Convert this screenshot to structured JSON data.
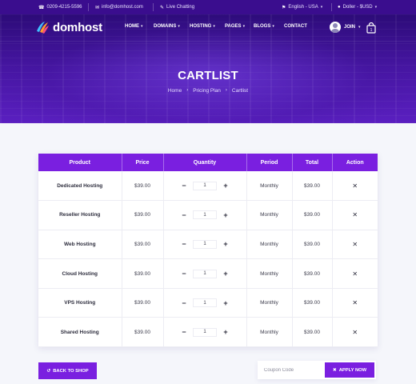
{
  "topbar": {
    "phone": "0209-4215-5596",
    "email": "info@domhost.com",
    "chat": "Live Chatting",
    "language": "English - USA",
    "currency": "Doller - $USD"
  },
  "brand": {
    "name": "domhost"
  },
  "nav": {
    "items": [
      {
        "label": "HOME"
      },
      {
        "label": "DOMAINS"
      },
      {
        "label": "HOSTING"
      },
      {
        "label": "PAGES"
      },
      {
        "label": "BLOGS"
      },
      {
        "label": "CONTACT"
      }
    ],
    "join_label": "JOIN"
  },
  "hero": {
    "title": "CARTLIST",
    "breadcrumb": [
      "Home",
      "Pricing Plan",
      "Cartlist"
    ]
  },
  "cart_table": {
    "headers": [
      "Product",
      "Price",
      "Quantity",
      "Period",
      "Total",
      "Action"
    ],
    "rows": [
      {
        "product": "Dedicated Hosting",
        "price": "$39.00",
        "quantity": "1",
        "period": "Monthly",
        "total": "$39.00"
      },
      {
        "product": "Reseller Hosting",
        "price": "$39.00",
        "quantity": "1",
        "period": "Monthly",
        "total": "$39.00"
      },
      {
        "product": "Web Hosting",
        "price": "$39.00",
        "quantity": "1",
        "period": "Monthly",
        "total": "$39.00"
      },
      {
        "product": "Cloud Hosting",
        "price": "$39.00",
        "quantity": "1",
        "period": "Monthly",
        "total": "$39.00"
      },
      {
        "product": "VPS Hosting",
        "price": "$39.00",
        "quantity": "1",
        "period": "Monthly",
        "total": "$39.00"
      },
      {
        "product": "Shared Hosting",
        "price": "$39.00",
        "quantity": "1",
        "period": "Monthly",
        "total": "$39.00"
      }
    ],
    "minus_symbol": "−",
    "plus_symbol": "+",
    "remove_symbol": "✕"
  },
  "actions": {
    "back_label": "BACK TO SHOP",
    "coupon_placeholder": "Coupon Code",
    "apply_label": "APPLY NOW"
  },
  "colors": {
    "accent": "#7a1fe0",
    "topbar": "#3a0d8e",
    "hero_dark": "#2c0b78"
  }
}
